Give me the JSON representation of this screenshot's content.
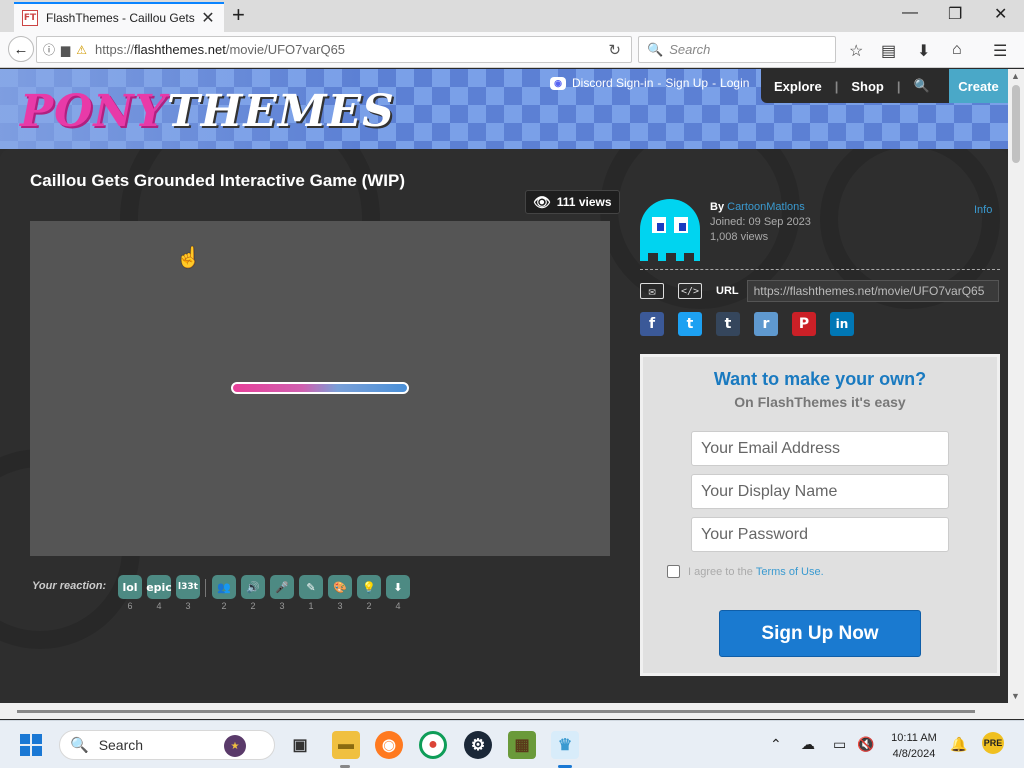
{
  "browser": {
    "tab_title": "FlashThemes - Caillou Gets",
    "favicon_text": "FT",
    "url_prefix": "https://",
    "url_host": "flashthemes.net",
    "url_path": "/movie/UFO7varQ65",
    "search_placeholder": "Search"
  },
  "site": {
    "logo_pony": "PONY",
    "logo_themes": "THEMES",
    "discord_auth": "Discord Sign-in",
    "signup": "Sign Up",
    "login": "Login",
    "dash": "-",
    "menu": [
      "Explore",
      "Shop"
    ],
    "create": "Create"
  },
  "movie": {
    "title": "Caillou Gets Grounded Interactive Game (WIP)",
    "views": "111 views",
    "loading_progress": 1.0
  },
  "reactions": {
    "label": "Your reaction:",
    "items": [
      {
        "icon": "lol",
        "count": "6",
        "name": "lol"
      },
      {
        "icon": "epic",
        "count": "4",
        "name": "epic"
      },
      {
        "icon": "l33t",
        "count": "3",
        "name": "l33t"
      },
      {
        "icon": "👥",
        "count": "2",
        "name": "people"
      },
      {
        "icon": "🔊",
        "count": "2",
        "name": "sound"
      },
      {
        "icon": "🎤",
        "count": "3",
        "name": "mic"
      },
      {
        "icon": "✎",
        "count": "1",
        "name": "draw"
      },
      {
        "icon": "🎨",
        "count": "3",
        "name": "palette"
      },
      {
        "icon": "💡",
        "count": "2",
        "name": "idea"
      },
      {
        "icon": "⬇",
        "count": "4",
        "name": "download"
      }
    ]
  },
  "author": {
    "by": "By",
    "name": "CartoonMatlons",
    "joined": "Joined: 09 Sep 2023",
    "views": "1,008 views",
    "info": "Info"
  },
  "share": {
    "url_label": "URL",
    "url_value": "https://flashthemes.net/movie/UFO7varQ65",
    "embed_icon": "</>",
    "social": [
      {
        "name": "facebook",
        "glyph": "f",
        "color": "#3b5998"
      },
      {
        "name": "twitter",
        "glyph": "t",
        "color": "#1da1f2"
      },
      {
        "name": "tumblr",
        "glyph": "t",
        "color": "#35465c"
      },
      {
        "name": "reddit",
        "glyph": "r",
        "color": "#5f99cf"
      },
      {
        "name": "pinterest",
        "glyph": "P",
        "color": "#cb2027"
      },
      {
        "name": "linkedin",
        "glyph": "in",
        "color": "#0077b5"
      }
    ]
  },
  "signup_panel": {
    "title": "Want to make your own?",
    "subtitle": "On FlashThemes it's easy",
    "email_placeholder": "Your Email Address",
    "display_placeholder": "Your Display Name",
    "password_placeholder": "Your Password",
    "agree_text": "I agree to the",
    "terms_link": "Terms of Use.",
    "button": "Sign Up Now"
  },
  "taskbar": {
    "search": "Search",
    "time": "10:11 AM",
    "date": "4/8/2024"
  },
  "colors": {
    "accent_blue": "#1a7ad0",
    "link_blue": "#3a9ad0",
    "reaction_teal": "#4d8a83",
    "pony_pink": "#e83aa8"
  }
}
